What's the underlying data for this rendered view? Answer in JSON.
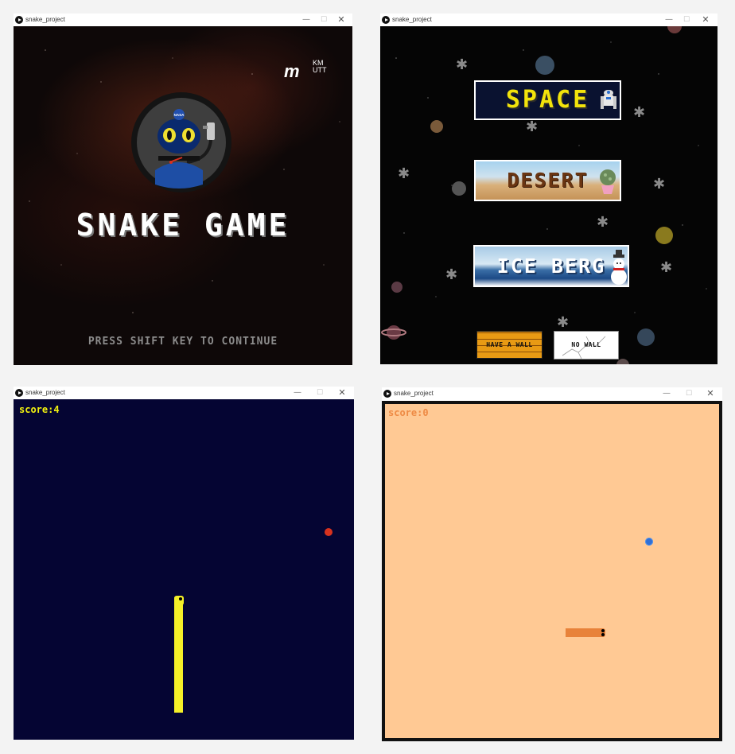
{
  "windows": {
    "title_screen": {
      "title": "snake_project",
      "controls": {
        "minimize": "—",
        "maximize": "☐",
        "close": "✕"
      },
      "brand_logo": "m",
      "brand_kmutt": "KM UTT",
      "game_title": "SNAKE GAME",
      "prompt": "PRESS SHIFT KEY TO CONTINUE",
      "badge_label": "NASA",
      "colors": {
        "background": "#0e0808",
        "title": "#ffffff",
        "prompt": "#8c8c8c"
      }
    },
    "theme_select": {
      "title": "snake_project",
      "controls": {
        "minimize": "—",
        "maximize": "☐",
        "close": "✕"
      },
      "themes": [
        {
          "label": "SPACE",
          "icon": "robot-icon"
        },
        {
          "label": "DESERT",
          "icon": "cactus-icon"
        },
        {
          "label": "ICE BERG",
          "icon": "snowman-icon"
        }
      ],
      "wall_options": {
        "have_wall": "HAVE A WALL",
        "no_wall": "NO WALL"
      },
      "colors": {
        "space_text": "#f2e30b",
        "desert_text": "#6a3512",
        "iceberg_text": "#ffffff",
        "wall": "#e89a14"
      }
    },
    "space_game": {
      "title": "snake_project",
      "controls": {
        "minimize": "—",
        "maximize": "☐",
        "close": "✕"
      },
      "score": "score:4",
      "colors": {
        "background": "#050533",
        "snake": "#f5f028",
        "food": "#d8321e",
        "score": "#f2f20f"
      }
    },
    "desert_game": {
      "title": "snake_project",
      "controls": {
        "minimize": "—",
        "maximize": "☐",
        "close": "✕"
      },
      "score": "score:0",
      "colors": {
        "background": "#ffc994",
        "snake": "#e8823a",
        "food": "#2f6fd6",
        "score": "#ee8a44",
        "border": "#111111"
      }
    }
  }
}
